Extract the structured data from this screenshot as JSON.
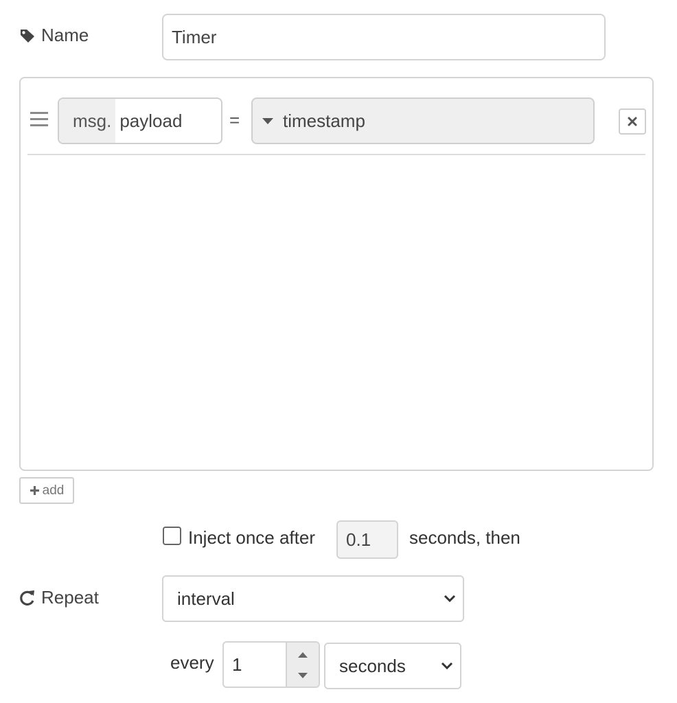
{
  "name_row": {
    "label": "Name",
    "icon": "tag-icon",
    "value": "Timer"
  },
  "rule": {
    "type_prefix": "msg.",
    "property": "payload",
    "operator": "=",
    "value_type": "timestamp",
    "remove_icon": "close-icon",
    "handle_icon": "drag-handle-icon"
  },
  "add_button": {
    "icon": "plus-icon",
    "label": "add"
  },
  "inject_once": {
    "checked": false,
    "label": "Inject once after",
    "delay": "0.1",
    "suffix": "seconds, then"
  },
  "repeat": {
    "label": "Repeat",
    "icon": "refresh-icon",
    "mode": "interval",
    "every_label": "every",
    "every_value": "1",
    "unit": "seconds"
  }
}
